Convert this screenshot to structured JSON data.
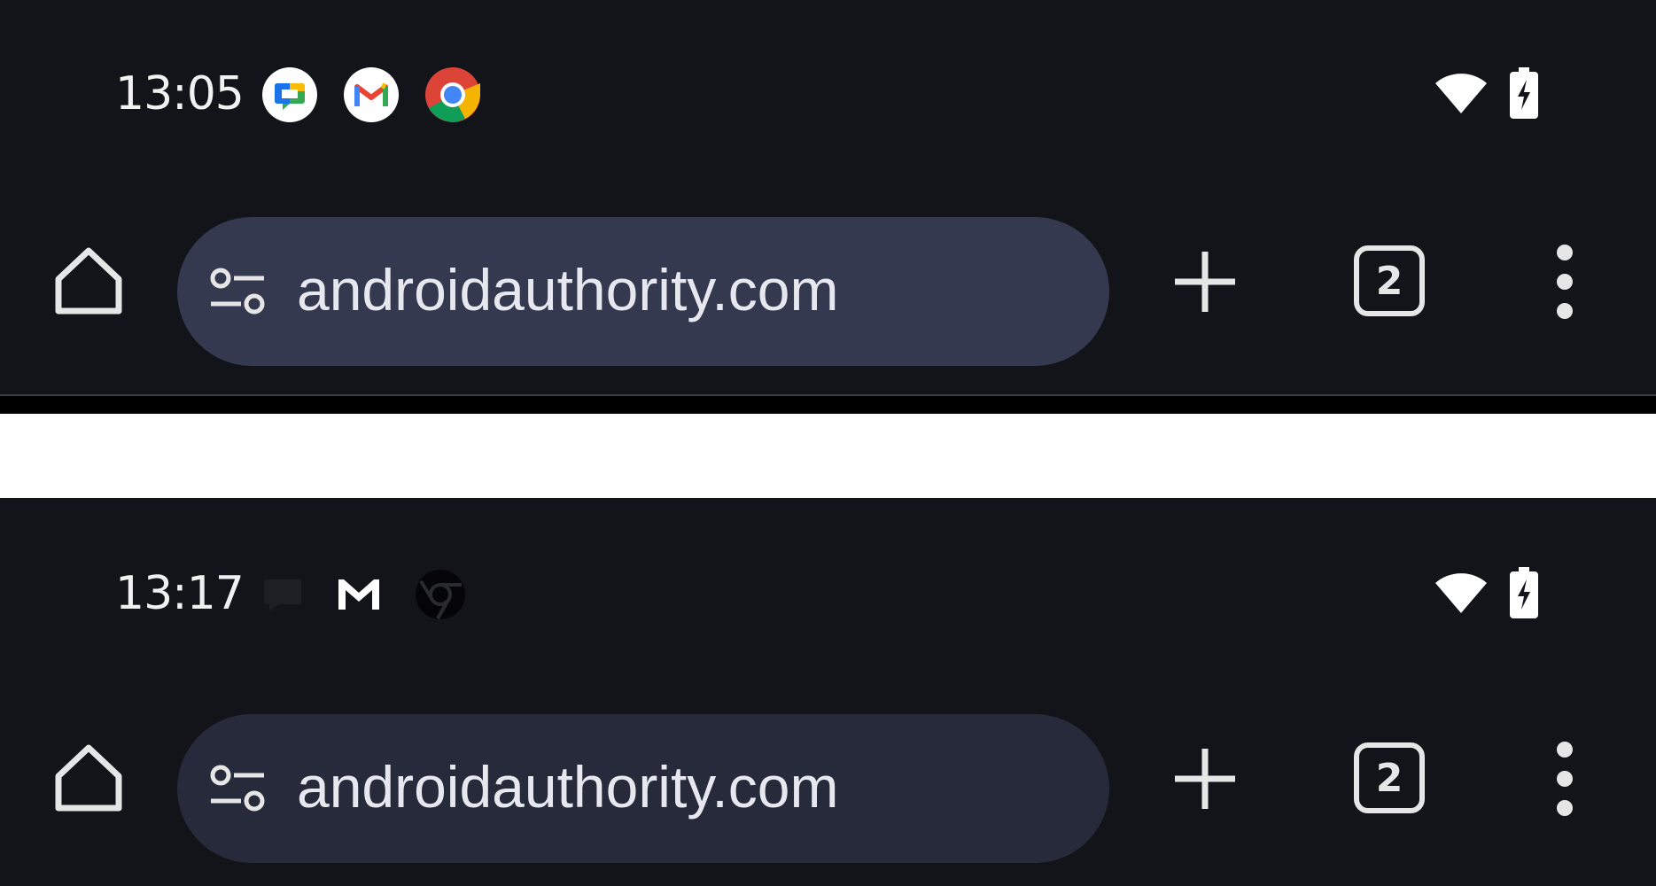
{
  "screens": [
    {
      "status_bar": {
        "time": "13:05",
        "notification_icons": [
          "google-chat-icon",
          "gmail-icon",
          "chrome-icon"
        ],
        "icon_style": "color"
      },
      "toolbar": {
        "url": "androidauthority.com",
        "tab_count": "2"
      }
    },
    {
      "status_bar": {
        "time": "13:17",
        "notification_icons": [
          "google-chat-icon",
          "gmail-icon",
          "chrome-icon"
        ],
        "icon_style": "monochrome"
      },
      "toolbar": {
        "url": "androidauthority.com",
        "tab_count": "2"
      }
    }
  ],
  "colors": {
    "background": "#131419",
    "omnibox_top": "#34394f",
    "omnibox_bottom": "#262a3a",
    "icon": "#e6e6e6",
    "separator": "#ffffff"
  }
}
